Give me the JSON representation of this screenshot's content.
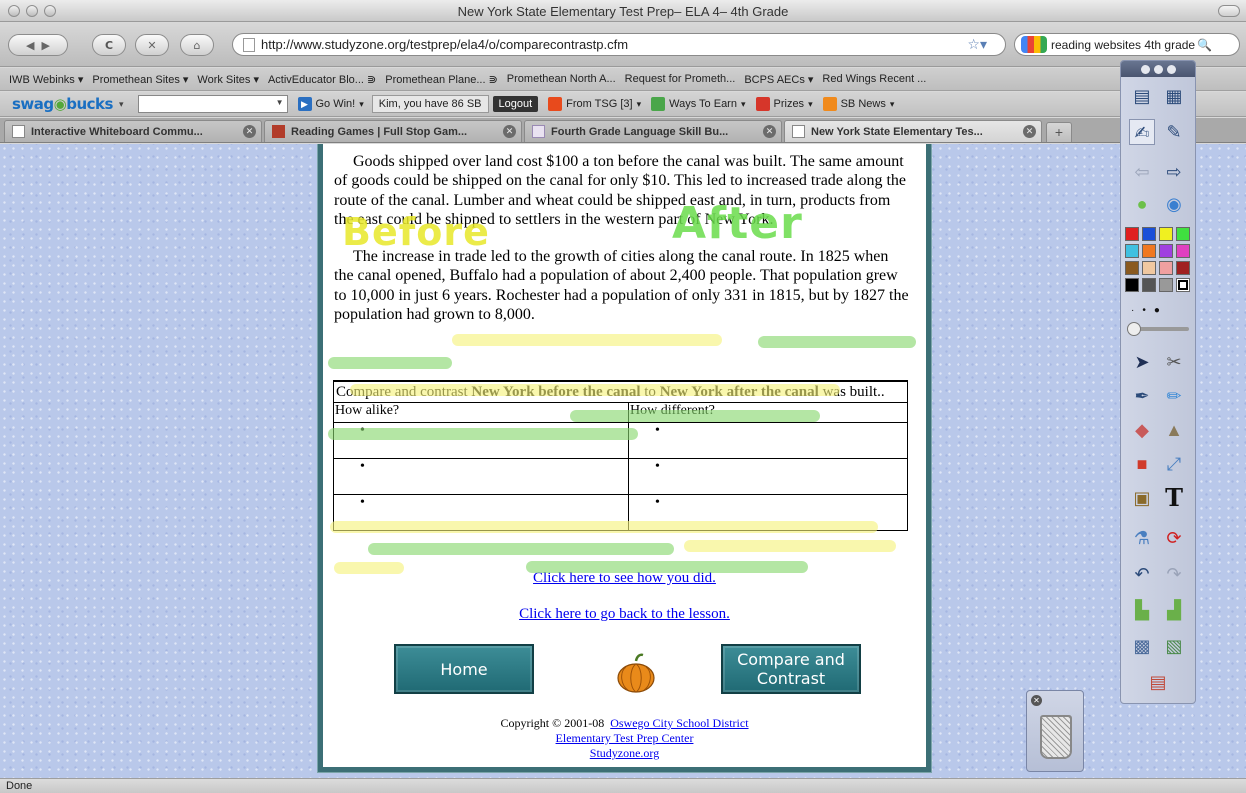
{
  "window": {
    "title": "New York State Elementary Test Prep– ELA 4– 4th Grade"
  },
  "nav": {
    "url": "http://www.studyzone.org/testprep/ela4/o/comparecontrastp.cfm",
    "search": "reading websites 4th grade"
  },
  "bookmarks": [
    "IWB Webinks ▾",
    "Promethean Sites ▾",
    "Work Sites ▾",
    "ActivEducator Blo... ⋑",
    "Promethean Plane... ⋑",
    "Promethean North A...",
    "Request for Prometh...",
    "BCPS AECs ▾",
    "Red Wings Recent ..."
  ],
  "swagbar": {
    "logo_a": "swag",
    "logo_b": "bucks",
    "go": "Go Win!",
    "kim": "Kim, you have 86 SB",
    "logout": "Logout",
    "tsg": "From TSG [3]",
    "ways": "Ways To Earn",
    "prizes": "Prizes",
    "news": "SB News"
  },
  "tabs": [
    "Interactive Whiteboard Commu...",
    "Reading Games | Full Stop Gam...",
    "Fourth Grade Language Skill Bu...",
    "New York State Elementary Tes..."
  ],
  "content": {
    "para1": "Goods shipped over land cost $100 a ton before the canal was built.  The same amount of goods could be shipped on the canal for only $10.  This led to increased trade along the route of the canal.  Lumber and wheat could be shipped east and, in turn, products from the east could be shipped to settlers in the western part of New York.",
    "para2": "The increase in trade led to the growth of cities along the canal route.  In 1825 when the canal opened, Buffalo had a population of about 2,400 people.  That population grew to 10,000 in just 6 years.  Rochester had a population of only 331 in 1815, but by 1827 the population had grown to 8,000.",
    "prompt_a": "Compare and contrast ",
    "prompt_b": "New York before the canal",
    "prompt_c": " to ",
    "prompt_d": "New York after the canal",
    "prompt_e": " was built..",
    "col_alike": "How alike?",
    "col_diff": "How different?",
    "bullet": "•",
    "link_check": "Click here to see how you did.",
    "link_back": "Click here to go back to the lesson.",
    "btn_home": "Home",
    "btn_compare": "Compare and Contrast",
    "copyright": "Copyright © 2001-08",
    "oswego": "Oswego City School District",
    "etpc": "Elementary Test Prep Center",
    "sz": "Studyzone.org"
  },
  "annotations": {
    "before": "Before",
    "after": "After"
  },
  "status": "Done",
  "colors": {
    "frame": "#3c6f76",
    "button": "#2d7b85",
    "link": "#0000ee",
    "highlight_green": "#86d66c",
    "highlight_yellow": "#f6f27a",
    "ink_yellow": "#e8e82a",
    "ink_green": "#6adc4c"
  }
}
